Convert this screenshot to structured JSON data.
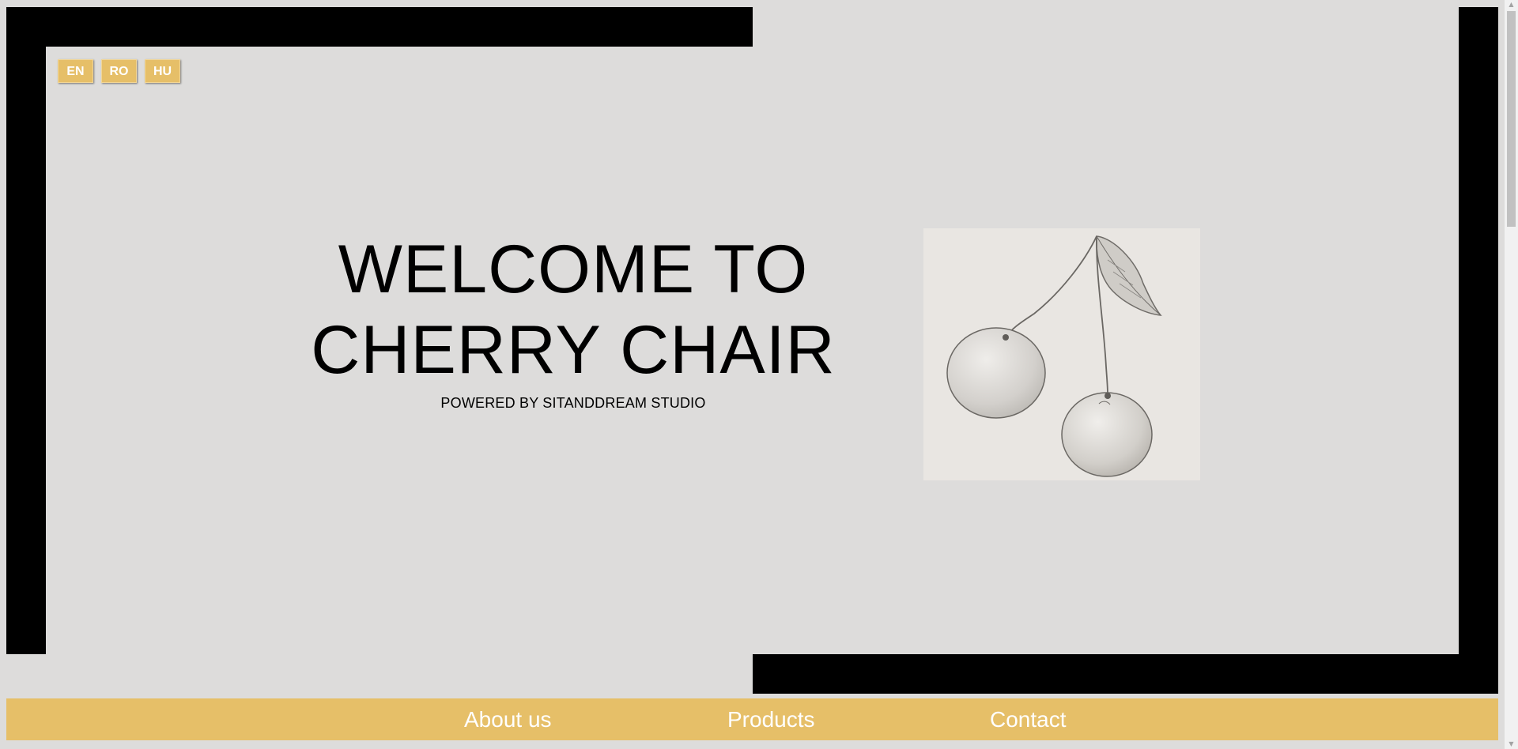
{
  "language_switcher": {
    "options": [
      "EN",
      "RO",
      "HU"
    ]
  },
  "hero": {
    "title_line1": "WELCOME TO",
    "title_line2": "CHERRY CHAIR",
    "subtitle": "POWERED BY SITANDDREAM STUDIO",
    "image_alt": "cherry-sketch"
  },
  "nav": {
    "items": [
      "About us",
      "Products",
      "Contact"
    ]
  },
  "colors": {
    "accent": "#e6bf68",
    "background": "#dddcdb",
    "frame": "#000000",
    "nav_text": "#ffffff"
  }
}
